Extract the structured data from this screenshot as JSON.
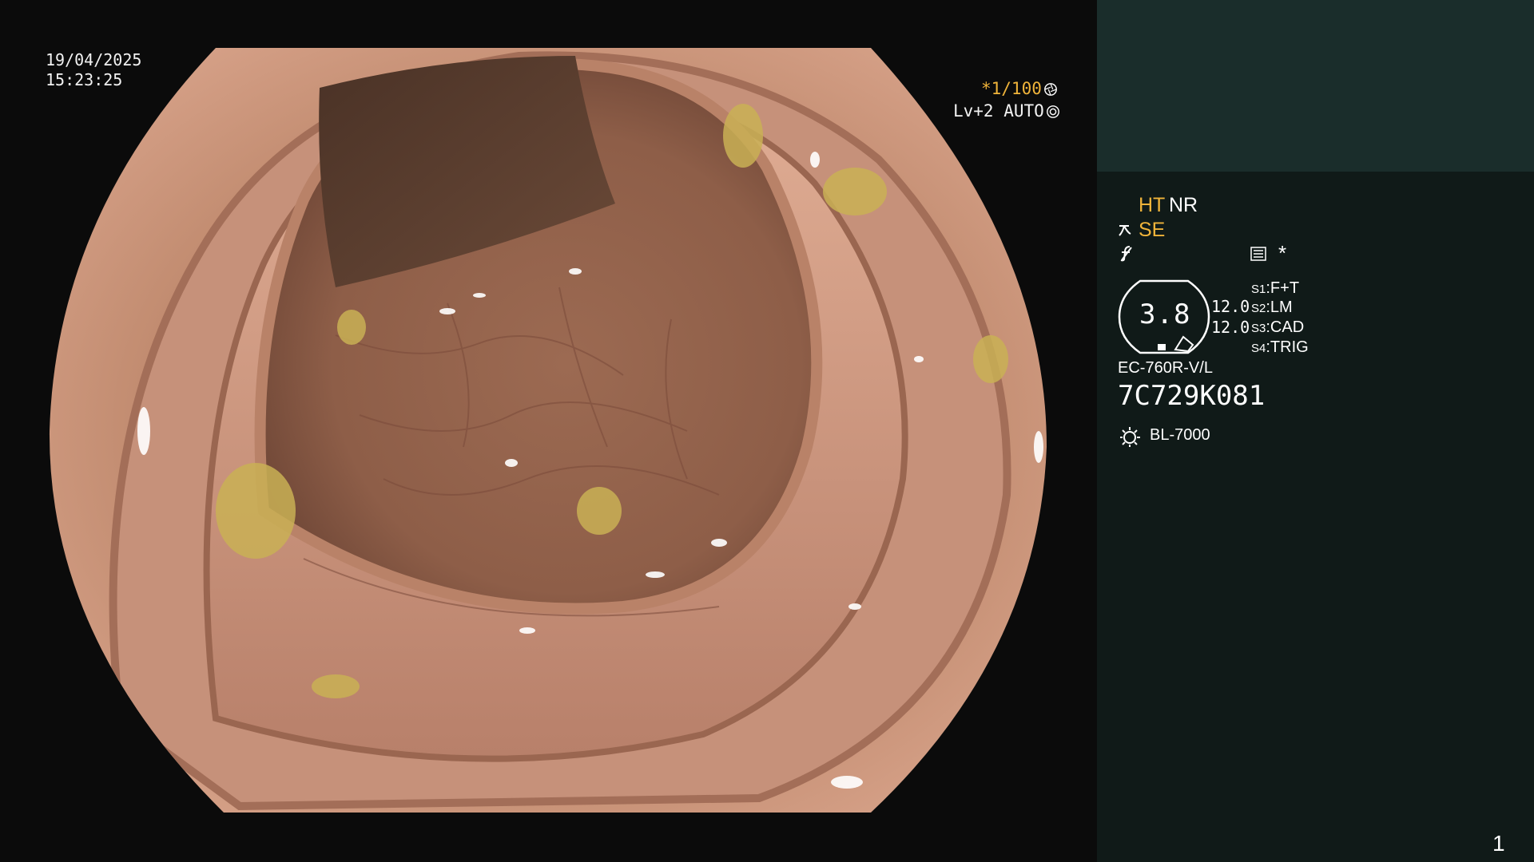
{
  "osd": {
    "date": "19/04/2025",
    "time": "15:23:25",
    "shutter": "*1/100",
    "level": "Lv+2 AUTO"
  },
  "panel": {
    "ht": "HT",
    "nr": "NR",
    "se": "SE",
    "asterisk": "*",
    "gauge_value": "3.8",
    "gauge_line1": "12.0",
    "gauge_line2": "12.0",
    "settings": [
      {
        "key": "S1",
        "value": "F+T"
      },
      {
        "key": "S2",
        "value": "LM"
      },
      {
        "key": "S3",
        "value": "CAD"
      },
      {
        "key": "S4",
        "value": "TRIG"
      }
    ],
    "scope_model": "EC-760R-V/L",
    "serial": "7C729K081",
    "light_source": "BL-7000",
    "page_number": "1"
  },
  "colors": {
    "panel_bg": "#101a18",
    "panel_top_bg": "#1a2d2b",
    "accent_orange": "#f0b43a",
    "tissue": "#b57c62"
  },
  "icons": {
    "shutter_icon": "aperture-icon",
    "auto_icon": "brightness-auto-icon",
    "se_icon": "structure-enhancement-icon",
    "f_icon": "function-icon",
    "list_icon": "settings-list-icon",
    "lamp_icon": "light-source-icon"
  }
}
